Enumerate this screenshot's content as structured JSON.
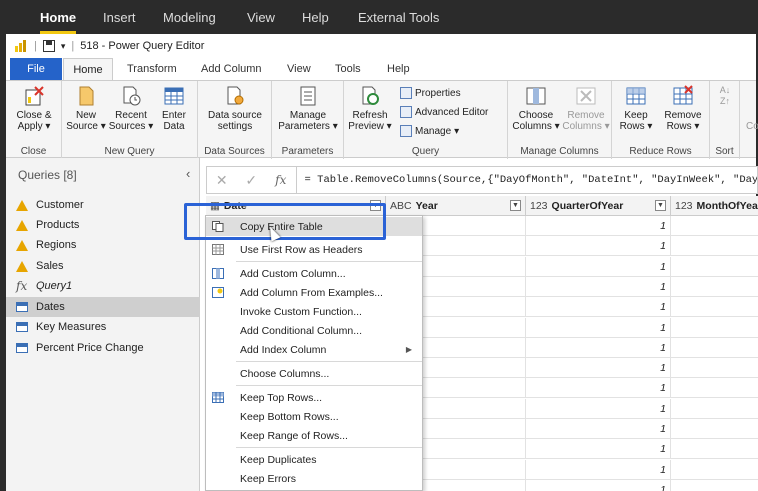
{
  "app_tabs": [
    "Home",
    "Insert",
    "Modeling",
    "View",
    "Help",
    "External Tools"
  ],
  "window": {
    "title": "518 - Power Query Editor"
  },
  "ribbon_tabs": [
    "File",
    "Home",
    "Transform",
    "Add Column",
    "View",
    "Tools",
    "Help"
  ],
  "ribbon": {
    "close_apply": "Close & Apply",
    "new_source": "New Source",
    "recent_sources": "Recent Sources",
    "enter_data": "Enter Data",
    "data_source_settings": "Data source settings",
    "manage_parameters": "Manage Parameters",
    "refresh_preview": "Refresh Preview",
    "properties": "Properties",
    "advanced_editor": "Advanced Editor",
    "manage": "Manage",
    "choose_columns": "Choose Columns",
    "remove_columns": "Remove Columns",
    "keep_rows": "Keep Rows",
    "remove_rows": "Remove Rows",
    "sort_label": "Sort",
    "groups": {
      "close": "Close",
      "new_query": "New Query",
      "data_sources": "Data Sources",
      "parameters": "Parameters",
      "query": "Query",
      "manage_columns": "Manage Columns",
      "reduce_rows": "Reduce Rows",
      "sort": "Sort"
    }
  },
  "queries": {
    "header": "Queries [8]",
    "items": [
      {
        "label": "Customer",
        "icon": "warning-icon"
      },
      {
        "label": "Products",
        "icon": "warning-icon"
      },
      {
        "label": "Regions",
        "icon": "warning-icon"
      },
      {
        "label": "Sales",
        "icon": "warning-icon"
      },
      {
        "label": "Query1",
        "icon": "fx-icon"
      },
      {
        "label": "Dates",
        "icon": "table-icon",
        "selected": true
      },
      {
        "label": "Key Measures",
        "icon": "table-icon"
      },
      {
        "label": "Percent Price Change",
        "icon": "table-icon"
      }
    ]
  },
  "formula_bar": {
    "text": "= Table.RemoveColumns(Source,{\"DayOfMonth\", \"DateInt\", \"DayInWeek\", \"DayO"
  },
  "grid": {
    "columns": [
      {
        "type": "",
        "name": "Date"
      },
      {
        "type": "ABC",
        "name": "Year"
      },
      {
        "type": "123",
        "name": "QuarterOfYear"
      },
      {
        "type": "123",
        "name": "MonthOfYear"
      }
    ],
    "quarter_values": [
      "1",
      "1",
      "1",
      "1",
      "1",
      "1",
      "1",
      "1",
      "1",
      "1",
      "1",
      "1",
      "1",
      "1"
    ]
  },
  "context_menu": {
    "items": [
      {
        "label": "Copy Entire Table",
        "icon": "copy-icon"
      },
      {
        "label": "Use First Row as Headers",
        "icon": "table-icon"
      },
      {
        "label": "Add Custom Column...",
        "icon": "custom-column-icon"
      },
      {
        "label": "Add Column From Examples...",
        "icon": "examples-icon"
      },
      {
        "label": "Invoke Custom Function..."
      },
      {
        "label": "Add Conditional Column..."
      },
      {
        "label": "Add Index Column",
        "submenu": true
      },
      {
        "label": "Choose Columns..."
      },
      {
        "label": "Keep Top Rows...",
        "icon": "keep-rows-icon"
      },
      {
        "label": "Keep Bottom Rows..."
      },
      {
        "label": "Keep Range of Rows..."
      },
      {
        "label": "Keep Duplicates"
      },
      {
        "label": "Keep Errors"
      }
    ]
  },
  "colors": {
    "accent": "#2563c9",
    "highlight": "#2a62d6",
    "warning": "#e7a500"
  }
}
